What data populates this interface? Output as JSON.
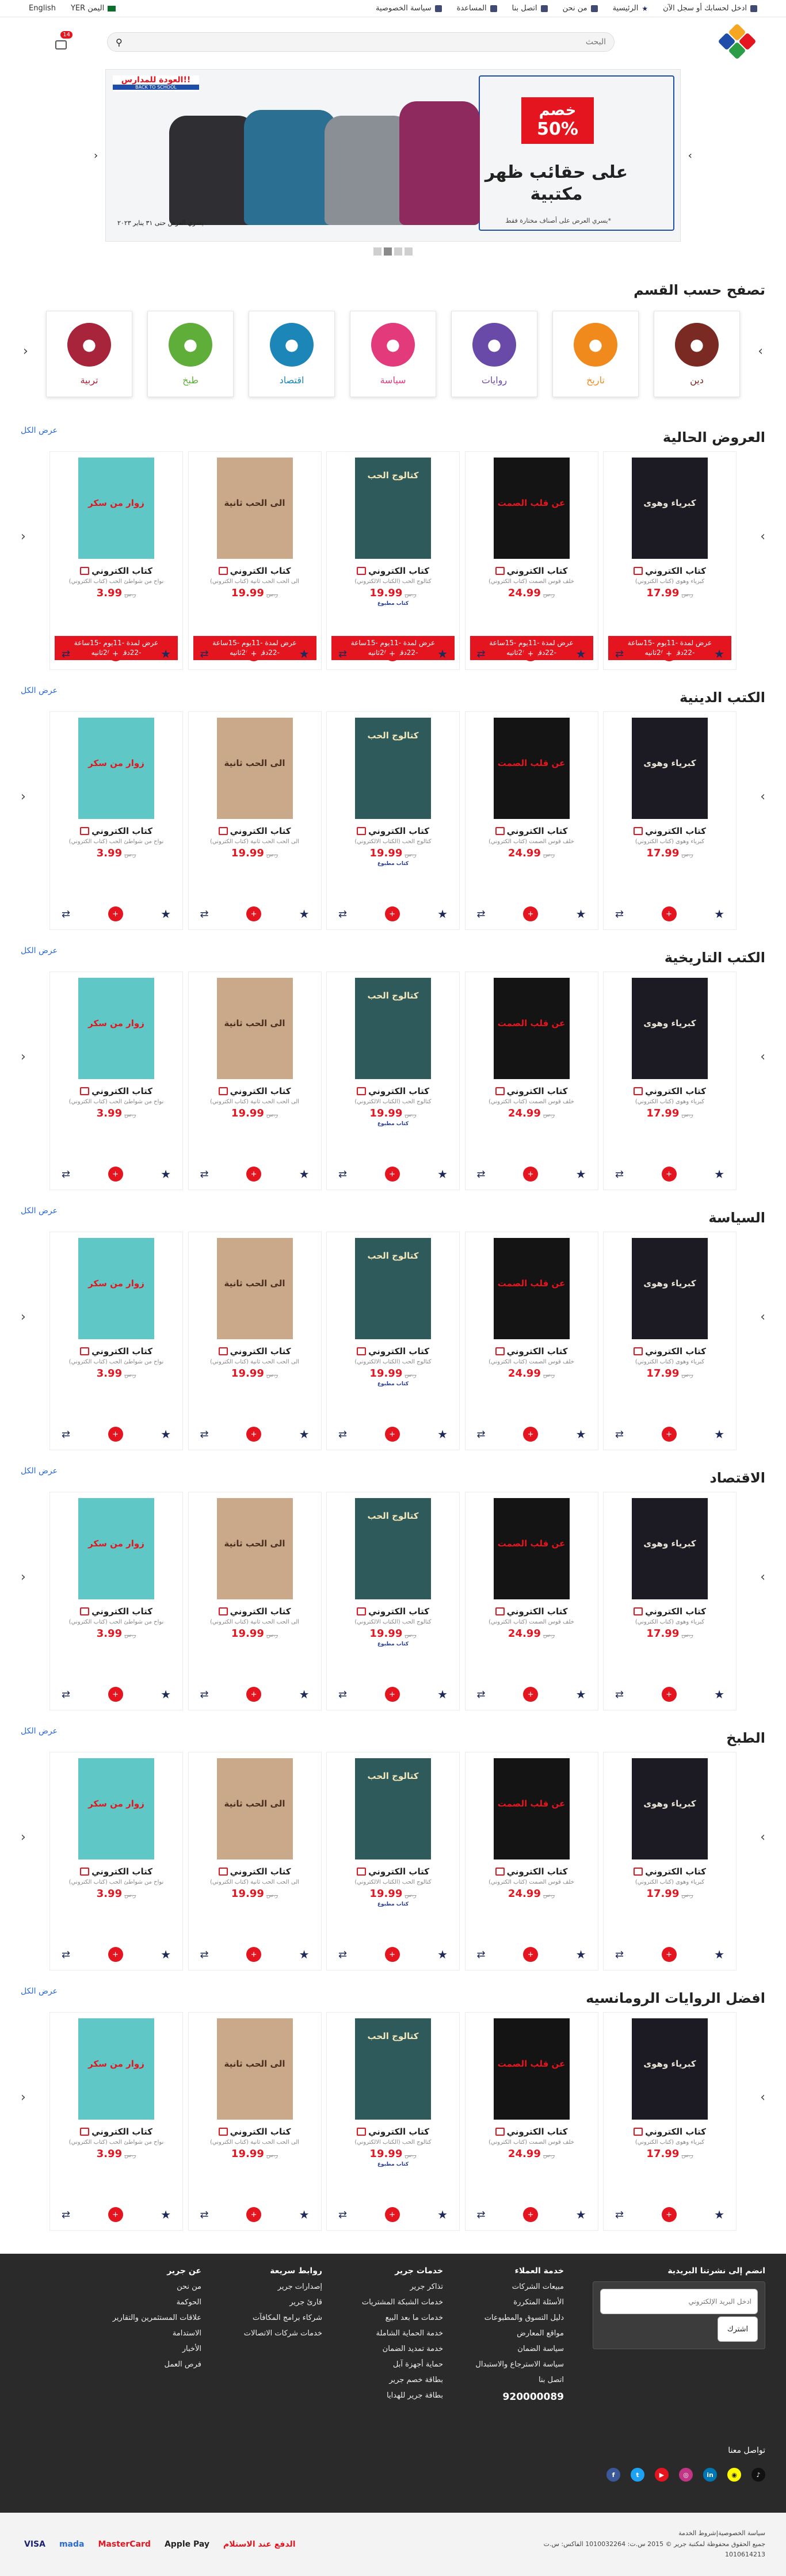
{
  "topbar": {
    "login": "ادخل لحسابك أو سجل الآن",
    "home": "الرئيسية",
    "about": "من نحن",
    "contact": "اتصل بنا",
    "help": "المساعدة",
    "privacy": "سياسة الخصوصية",
    "country_currency": "اليمن YER",
    "language": "English"
  },
  "header": {
    "search_placeholder": "البحث",
    "cart_count": "14"
  },
  "banner": {
    "badge_top": "!!العودة للمدارس",
    "badge_bottom": "BACK TO SCHOOL",
    "discount_line1": "خصم",
    "discount_line2": "50%",
    "headline": "على حقائب ظهر مكتبية",
    "note": "*يسري العرض على أصناف مختارة فقط",
    "valid": "يسري العرض حتى ٣١ يناير ٢٠٢٣"
  },
  "browse": {
    "title": "تصفح حسب القسم",
    "categories": [
      {
        "label": "دين",
        "icon": "monitor-icon",
        "color": "#7a2a22"
      },
      {
        "label": "تاريخ",
        "icon": "watch-icon",
        "color": "#f08a1c"
      },
      {
        "label": "روايات",
        "icon": "keyboard-icon",
        "color": "#6a4aa8"
      },
      {
        "label": "سياسة",
        "icon": "charger-icon",
        "color": "#e23a7a"
      },
      {
        "label": "اقتصاد",
        "icon": "home-icon",
        "color": "#1d86b8"
      },
      {
        "label": "طبخ",
        "icon": "gamepad-icon",
        "color": "#5fae3a"
      },
      {
        "label": "تربية",
        "icon": "phone-icon",
        "color": "#a8243a"
      }
    ]
  },
  "products": [
    {
      "type": "كتاب الكتروني",
      "desc": "كبرياء وهوى (كتاب الكتروني)",
      "price": "17.99",
      "old": "ر.س",
      "cover_title": "كبرياء وهوى",
      "cover_bg": "#1c1a22",
      "cover_fg": "#e8e4d8",
      "avail": "",
      "sub": "",
      "offer": "عرض لمدة -11يوم -15ساعة -22دقيقة-26ثانيه"
    },
    {
      "type": "كتاب الكتروني",
      "desc": "خلف قوس الصمت (كتاب الكتروني)",
      "price": "24.99",
      "old": "ر.س",
      "cover_title": "عن قلب الصمت",
      "cover_bg": "#141414",
      "cover_fg": "#e4151f",
      "avail": "",
      "sub": "",
      "offer": "عرض لمدة -11يوم -15ساعة -22دقيقة-26ثانيه"
    },
    {
      "type": "كتاب الكتروني",
      "desc": "كتالوج الحب (الكتاب الالكتروني)",
      "price": "19.99",
      "old": "ر.س",
      "cover_title": "كتالوج الحب",
      "cover_bg": "#2f5a5c",
      "cover_fg": "#f3e6b8",
      "avail": "",
      "sub": "كتاب مطبوع",
      "offer": "عرض لمدة -11يوم -15ساعة -22دقيقة-26ثانيه"
    },
    {
      "type": "كتاب الكتروني",
      "desc": "الى الحب الحب ثانية (كتاب الكتروني)",
      "price": "19.99",
      "old": "ر.س",
      "cover_title": "الى الحب ثانية",
      "cover_bg": "#c9a98a",
      "cover_fg": "#4a2e1e",
      "avail": "",
      "sub": "",
      "offer": "عرض لمدة -11يوم -15ساعة -22دقيقة-26ثانيه"
    },
    {
      "type": "كتاب الكتروني",
      "desc": "نواح من شواطئ الحب (كتاب الكتروني)",
      "price": "3.99",
      "old": "ر.س",
      "cover_title": "زوار من سكر",
      "cover_bg": "#5fc7c5",
      "cover_fg": "#e4151f",
      "avail": "",
      "sub": "",
      "offer": "عرض لمدة -11يوم -15ساعة -22دقيقة-26ثانيه"
    }
  ],
  "sections": [
    {
      "title": "العروض الحالية",
      "view_all": "عرض الكل",
      "offers": true
    },
    {
      "title": "الكتب الدينية",
      "view_all": "عرض الكل",
      "offers": false
    },
    {
      "title": "الكتب التاريخية",
      "view_all": "عرض الكل",
      "offers": false
    },
    {
      "title": "السياسة",
      "view_all": "عرض الكل",
      "offers": false
    },
    {
      "title": "الاقتصاد",
      "view_all": "عرض الكل",
      "offers": false
    },
    {
      "title": "الطبخ",
      "view_all": "عرض الكل",
      "offers": false
    },
    {
      "title": "افضل الروايات الرومانسيه",
      "view_all": "عرض الكل",
      "offers": false
    }
  ],
  "footer": {
    "newsletter_title": "انضم إلى نشرتنا البريدية",
    "newsletter_placeholder": "ادخل البريد الإلكتروني",
    "newsletter_button": "اشترك",
    "customer_service": {
      "title": "خدمة العملاء",
      "links": [
        "مبيعات الشركات",
        "الأسئلة المتكررة",
        "دليل التسوق والمطبوعات",
        "مواقع المعارض",
        "سياسة الضمان",
        "سياسة الاسترجاع والاستبدال",
        "اتصل بنا"
      ]
    },
    "services": {
      "title": "خدمات جرير",
      "links": [
        "تذاكر جرير",
        "خدمات الشبكة المشتريات",
        "خدمات ما بعد البيع",
        "خدمة الحماية الشاملة",
        "خدمة تمديد الضمان",
        "حماية أجهزة آبل",
        "بطاقة خصم جرير",
        "بطاقة جرير للهدايا"
      ]
    },
    "quick_links": {
      "title": "روابط سريعة",
      "links": [
        "إصدارات جرير",
        "قارئ جرير",
        "شركاء برامج المكافآت",
        "خدمات شركات الاتصالات"
      ]
    },
    "about": {
      "title": "عن جرير",
      "links": [
        "من نحن",
        "الحوكمة",
        "علاقات المستثمرين والتقارير",
        "الاستدامة",
        "الأخبار",
        "فرص العمل"
      ]
    },
    "phone": "920000089",
    "social_title": "تواصل معنا",
    "socials": [
      "facebook-icon",
      "twitter-icon",
      "youtube-icon",
      "instagram-icon",
      "linkedin-icon",
      "snapchat-icon",
      "tiktok-icon"
    ],
    "legal_line1": "سياسة الخصوصية|شروط الخدمة",
    "legal_line2": "جميع الحقوق محفوظة لمكتبة جرير © 2015 س.ت: 1010032264 الفاكس: س.ت",
    "legal_line3": "1010614213",
    "payments": [
      "VISA",
      "mada",
      "MasterCard",
      "Apple Pay",
      "الدفع عند الاستلام"
    ]
  }
}
